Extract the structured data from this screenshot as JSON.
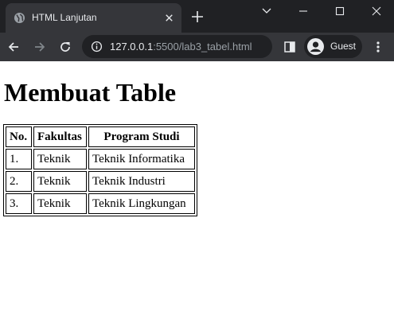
{
  "browser": {
    "tab": {
      "title": "HTML Lanjutan"
    },
    "address": {
      "host": "127.0.0.1",
      "path": ":5500/lab3_tabel.html"
    },
    "profile": {
      "name": "Guest"
    }
  },
  "page": {
    "heading": "Membuat Table",
    "table": {
      "headers": [
        "No.",
        "Fakultas",
        "Program Studi"
      ],
      "rows": [
        [
          "1.",
          "Teknik",
          "Teknik Informatika"
        ],
        [
          "2.",
          "Teknik",
          "Teknik Industri"
        ],
        [
          "3.",
          "Teknik",
          "Teknik Lingkungan"
        ]
      ]
    }
  },
  "colors": {
    "tabstrip": "#202124",
    "toolbar": "#35363a",
    "omnibox": "#202124",
    "text_light": "#e8eaed",
    "text_dim": "#9aa0a6"
  }
}
